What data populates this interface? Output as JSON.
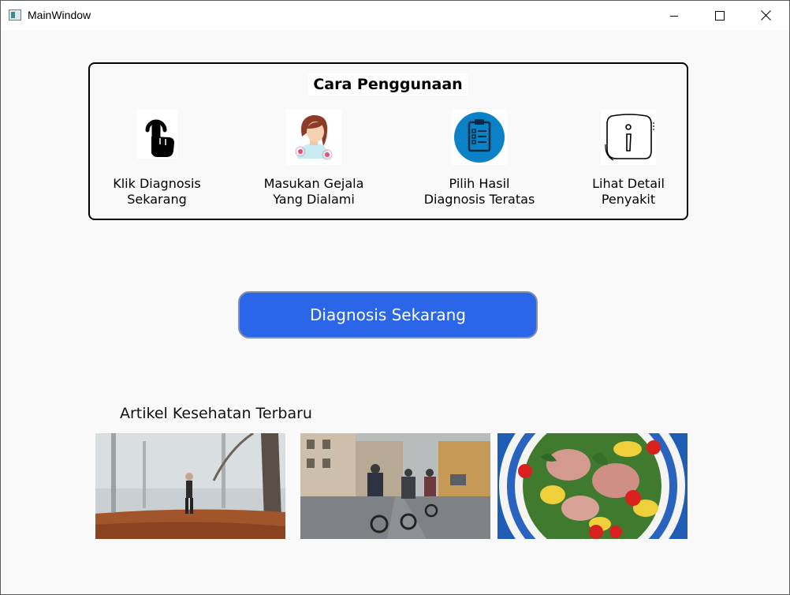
{
  "window": {
    "title": "MainWindow"
  },
  "guide": {
    "title": "Cara Penggunaan",
    "steps": [
      {
        "label": "Klik Diagnosis\nSekarang",
        "icon": "tap-finger-icon"
      },
      {
        "label": "Masukan Gejala\nYang Dialami",
        "icon": "woman-symptom-icon"
      },
      {
        "label": "Pilih Hasil\nDiagnosis Teratas",
        "icon": "clipboard-checklist-icon"
      },
      {
        "label": "Lihat Detail\nPenyakit",
        "icon": "info-icon"
      }
    ]
  },
  "cta": {
    "label": "Diagnosis Sekarang",
    "color": "#2b66e8"
  },
  "articles": {
    "title": "Artikel Kesehatan Terbaru",
    "items": [
      {
        "image": "jogging-foggy-park-photo"
      },
      {
        "image": "cyclists-street-photo"
      },
      {
        "image": "tuna-salad-bowl-photo"
      }
    ]
  }
}
